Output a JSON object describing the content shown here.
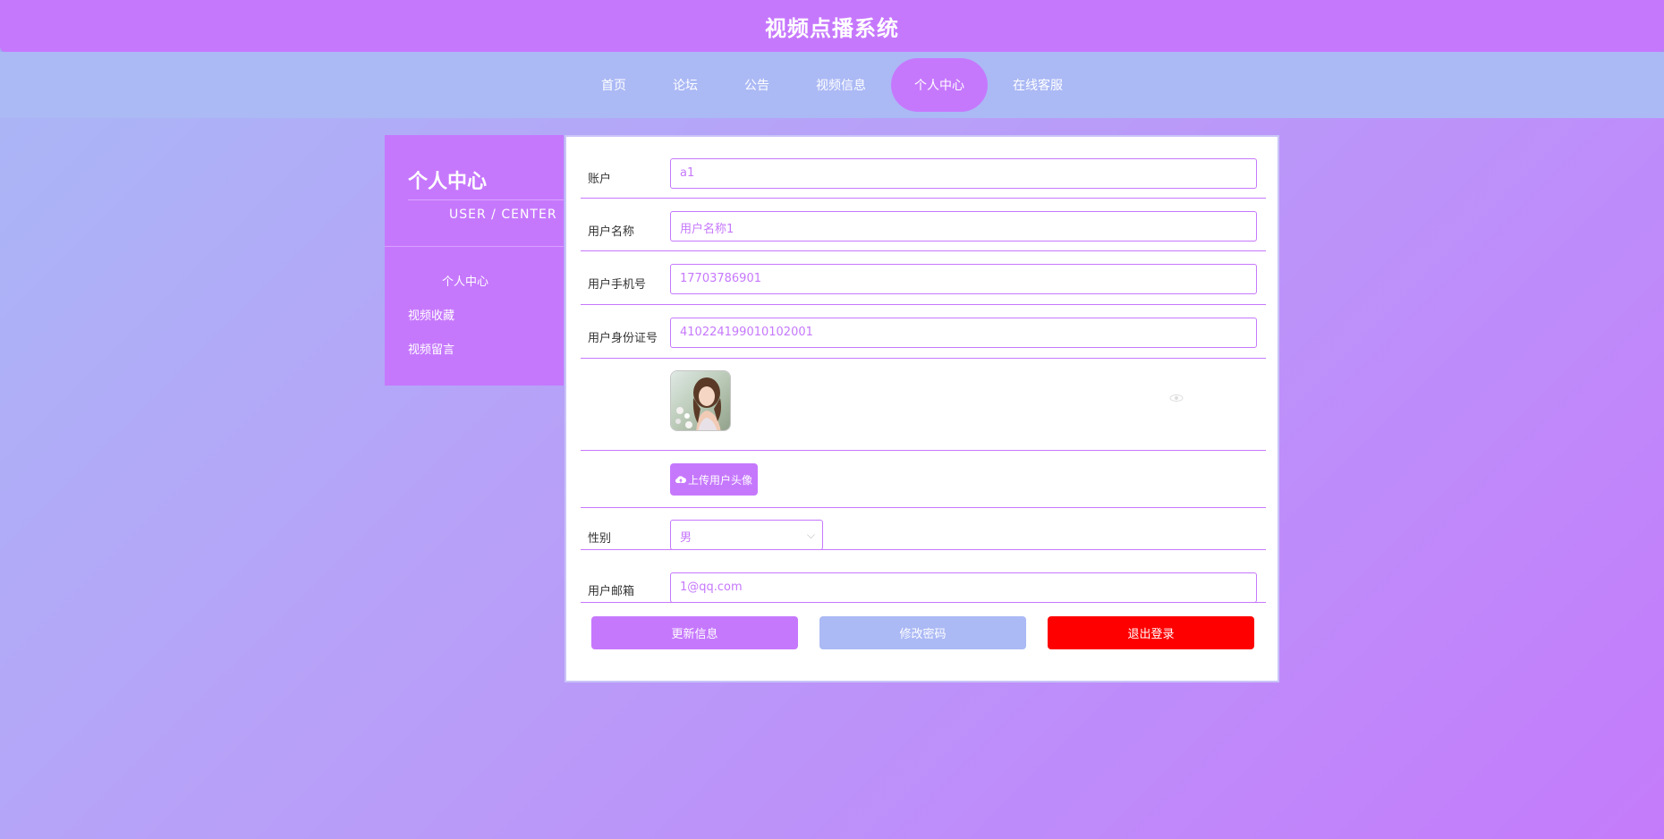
{
  "header": {
    "title": "视频点播系统"
  },
  "nav": {
    "items": [
      {
        "label": "首页"
      },
      {
        "label": "论坛"
      },
      {
        "label": "公告"
      },
      {
        "label": "视频信息"
      },
      {
        "label": "个人中心",
        "active": true
      },
      {
        "label": "在线客服"
      }
    ]
  },
  "sidebar": {
    "title": "个人中心",
    "subtitle": "USER / CENTER",
    "items": [
      {
        "label": "个人中心"
      },
      {
        "label": "视频收藏"
      },
      {
        "label": "视频留言"
      }
    ]
  },
  "form": {
    "account": {
      "label": "账户",
      "value": "a1"
    },
    "username": {
      "label": "用户名称",
      "value": "用户名称1"
    },
    "phone": {
      "label": "用户手机号",
      "value": "17703786901"
    },
    "idcard": {
      "label": "用户身份证号",
      "value": "410224199010102001"
    },
    "upload_label": "上传用户头像",
    "gender": {
      "label": "性别",
      "value": "男"
    },
    "email": {
      "label": "用户邮箱",
      "value": "1@qq.com"
    }
  },
  "buttons": {
    "update": "更新信息",
    "change_password": "修改密码",
    "logout": "退出登录"
  },
  "colors": {
    "accent": "#c678fd",
    "secondary": "#abb9f5",
    "danger": "#ff0000"
  }
}
